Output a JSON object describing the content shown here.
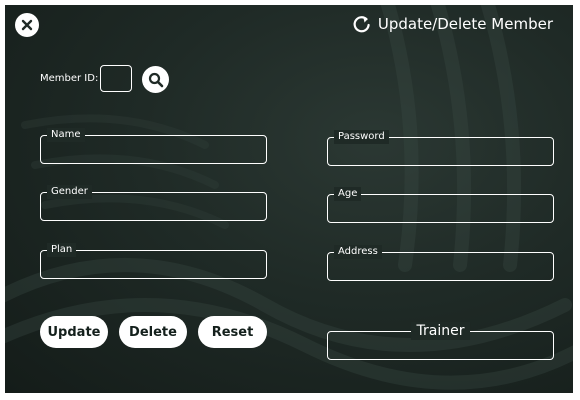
{
  "header": {
    "title": "Update/Delete Member",
    "close_icon": "close-x-icon",
    "refresh_icon": "refresh-icon"
  },
  "member_id": {
    "label": "Member ID:",
    "value": "",
    "search_icon": "search-icon"
  },
  "fields": {
    "name": {
      "label": "Name",
      "value": ""
    },
    "gender": {
      "label": "Gender",
      "value": ""
    },
    "plan": {
      "label": "Plan",
      "value": ""
    },
    "password": {
      "label": "Password",
      "value": ""
    },
    "age": {
      "label": "Age",
      "value": ""
    },
    "address": {
      "label": "Address",
      "value": ""
    },
    "trainer": {
      "label": "Trainer",
      "value": ""
    }
  },
  "buttons": {
    "update": "Update",
    "delete": "Delete",
    "reset": "Reset"
  },
  "colors": {
    "background": "#1f2a26",
    "foreground": "#ffffff",
    "button_text": "#14201c"
  }
}
